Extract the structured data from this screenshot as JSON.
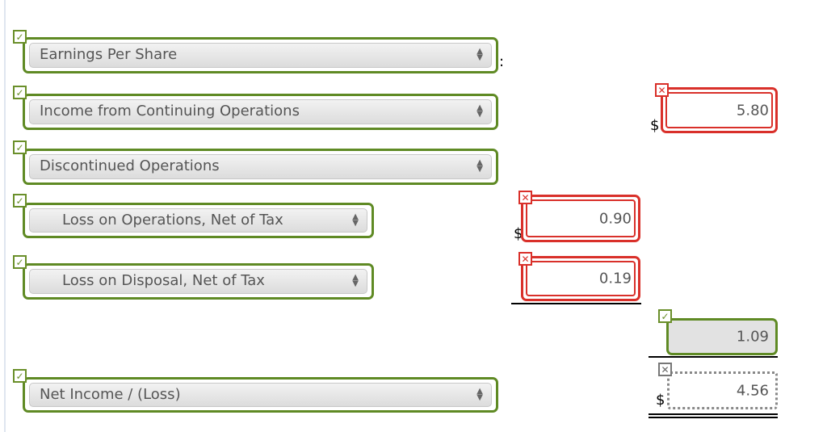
{
  "rows": [
    {
      "label": "Earnings Per Share",
      "status": "correct"
    },
    {
      "label": "Income from Continuing Operations",
      "status": "correct"
    },
    {
      "label": "Discontinued Operations",
      "status": "correct"
    },
    {
      "label": "Loss on Operations, Net of Tax",
      "status": "correct"
    },
    {
      "label": "Loss on Disposal, Net of Tax",
      "status": "correct"
    },
    {
      "label": "Net Income / (Loss)",
      "status": "correct"
    }
  ],
  "colon": ":",
  "currency": "$",
  "inputs": {
    "continuing_ops": {
      "value": "5.80",
      "status": "incorrect"
    },
    "loss_operations": {
      "value": "0.90",
      "status": "incorrect"
    },
    "loss_disposal": {
      "value": "0.19",
      "status": "incorrect"
    },
    "discontinued_total": {
      "value": "1.09",
      "status": "correct"
    },
    "net_income": {
      "value": "4.56",
      "status": "unanswered"
    }
  },
  "icons": {
    "correct": "✓",
    "incorrect": "✕",
    "unanswered": "✕"
  },
  "colors": {
    "correct": "#5f8a24",
    "incorrect": "#d9302a",
    "neutral": "#777777"
  }
}
